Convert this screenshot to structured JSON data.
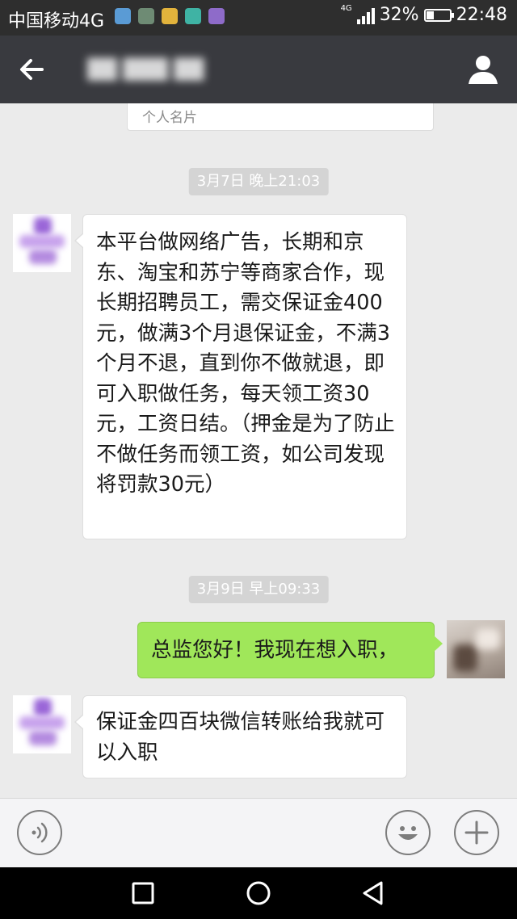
{
  "status_bar": {
    "carrier": "中国移动4G",
    "network": "4G",
    "battery": "32%",
    "battery_level": 0.32,
    "time": "22:48",
    "notification_icons": [
      {
        "name": "browser-notification-icon",
        "color": "#5a9bd5"
      },
      {
        "name": "gallery-notification-icon",
        "color": "#6e8b74"
      },
      {
        "name": "bank-notification-icon",
        "color": "#e2b33c"
      },
      {
        "name": "voicemail-notification-icon",
        "color": "#3fb3a4"
      },
      {
        "name": "messages-notification-icon",
        "color": "#8e6bc9"
      }
    ]
  },
  "title_bar": {
    "contact_name": "██ ███ ██",
    "back_icon": "arrow-left-icon",
    "profile_icon": "person-icon"
  },
  "chat": {
    "card_label": "个人名片",
    "timestamps": [
      "3月7日 晚上21:03",
      "3月9日 早上09:33"
    ],
    "messages": [
      {
        "direction": "in",
        "text": "本平台做网络广告，长期和京东、淘宝和苏宁等商家合作，现长期招聘员工，需交保证金400元，做满3个月退保证金，不满3个月不退，直到你不做就退，即可入职做任务，每天领工资30元，工资日结。（押金是为了防止不做任务而领工资，如公司发现将罚款30元）"
      },
      {
        "direction": "out",
        "text": "总监您好！我现在想入职，"
      },
      {
        "direction": "in",
        "text": "保证金四百块微信转账给我就可以入职"
      }
    ]
  },
  "input_bar": {
    "voice_icon": "voice-icon",
    "emoji_icon": "emoji-icon",
    "more_icon": "plus-icon"
  },
  "nav_bar": {
    "recents_icon": "square-icon",
    "home_icon": "circle-icon",
    "back_icon": "triangle-back-icon"
  },
  "colors": {
    "status_bar_bg": "#2e2e2e",
    "title_bar_bg": "#393a3f",
    "chat_bg": "#ebebeb",
    "outgoing_bubble": "#a0e75a",
    "incoming_bubble": "#ffffff",
    "timestamp_bg": "#d4d4d4"
  }
}
